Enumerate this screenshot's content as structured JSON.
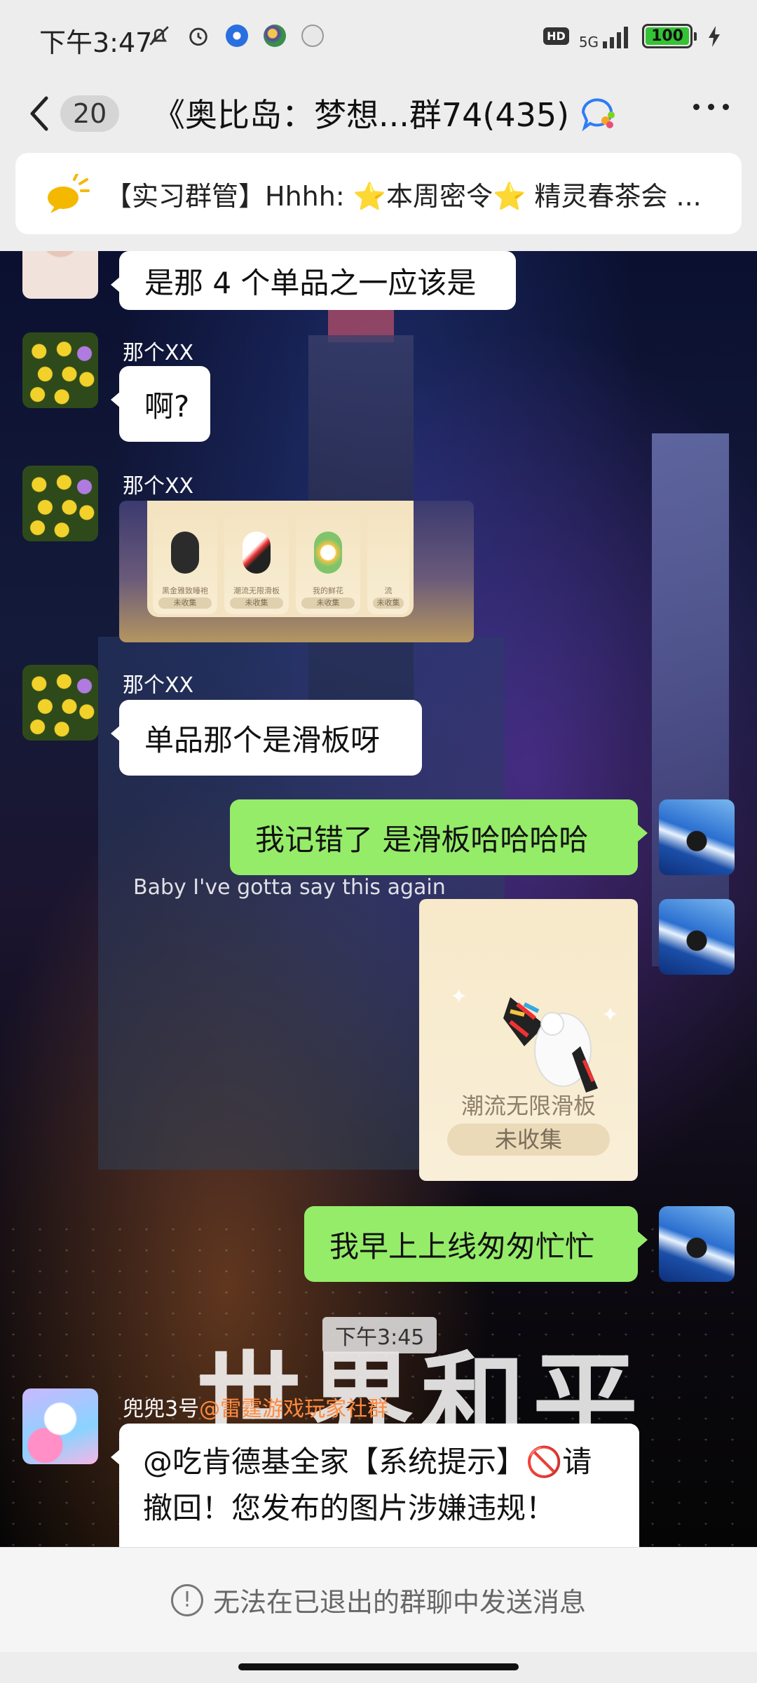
{
  "status_bar": {
    "time": "下午3:47",
    "network": "5G",
    "hd": "HD",
    "battery": "100"
  },
  "header": {
    "back_count": "20",
    "title": "《奥比岛：梦想...群74(435)"
  },
  "announcement": {
    "text": "【实习群管】Hhhh: ⭐本周密令⭐ 精灵春茶会 ..."
  },
  "messages": {
    "m1": {
      "text": "是那 4 个单品之一应该是"
    },
    "m2": {
      "sender": "那个XX",
      "text": "啊?"
    },
    "m3": {
      "sender": "那个XX",
      "cards": [
        {
          "name": "黑金雅致睡袍",
          "status": "未收集"
        },
        {
          "name": "潮流无限滑板",
          "status": "未收集"
        },
        {
          "name": "我的鲜花",
          "status": "未收集"
        },
        {
          "name": "流",
          "status": "未收集"
        }
      ]
    },
    "m4": {
      "sender": "那个XX",
      "text": "单品那个是滑板呀"
    },
    "m5": {
      "text": "我记错了 是滑板哈哈哈哈"
    },
    "m6": {
      "item_name": "潮流无限滑板",
      "item_status": "未收集"
    },
    "m7": {
      "text": "我早上上线匆匆忙忙"
    },
    "timestamp": "下午3:45",
    "m8": {
      "sender": "兜兜3号",
      "sender_tag": "@雷霆游戏玩家社群",
      "text": "@吃肯德基全家【系统提示】🚫请撤回！您发布的图片涉嫌违规！"
    }
  },
  "background": {
    "lyric": "Baby I've gotta say this again",
    "big_text": "世界和平"
  },
  "footer": {
    "notice": "无法在已退出的群聊中发送消息"
  }
}
